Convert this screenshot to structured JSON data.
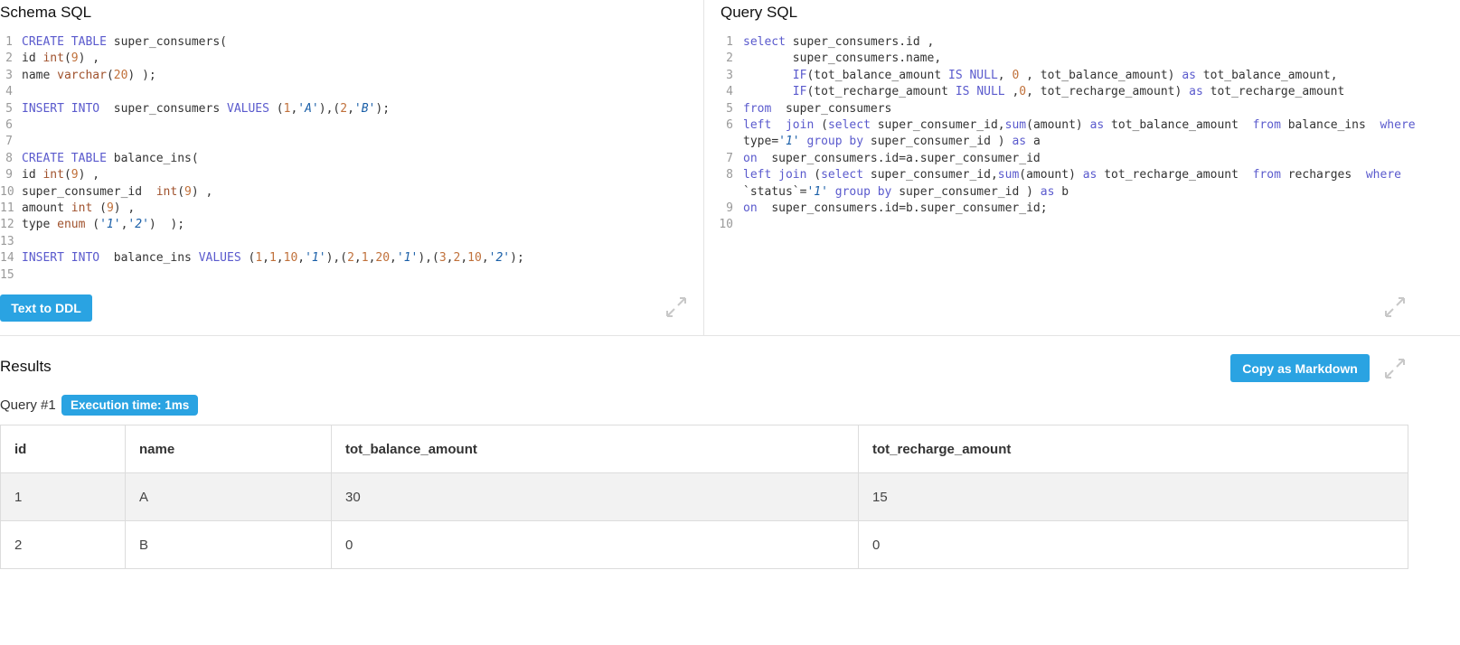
{
  "colors": {
    "accent": "#2aa3e2",
    "keyword": "#5a5acd",
    "type": "#a0522d",
    "string": "#1a5fa8",
    "number": "#c0703a",
    "line_number": "#9a9a9a"
  },
  "schema": {
    "title": "Schema SQL",
    "lines": [
      {
        "n": "1",
        "code": "CREATE TABLE super_consumers("
      },
      {
        "n": "2",
        "code": "id int(9) ,"
      },
      {
        "n": "3",
        "code": "name varchar(20) );"
      },
      {
        "n": "4",
        "code": ""
      },
      {
        "n": "5",
        "code": "INSERT INTO  super_consumers VALUES (1,'A'),(2,'B');"
      },
      {
        "n": "6",
        "code": ""
      },
      {
        "n": "7",
        "code": ""
      },
      {
        "n": "8",
        "code": "CREATE TABLE balance_ins("
      },
      {
        "n": "9",
        "code": "id int(9) ,"
      },
      {
        "n": "10",
        "code": "super_consumer_id  int(9) ,"
      },
      {
        "n": "11",
        "code": "amount int (9) ,"
      },
      {
        "n": "12",
        "code": "type enum ('1','2')  );"
      },
      {
        "n": "13",
        "code": ""
      },
      {
        "n": "14",
        "code": "INSERT INTO  balance_ins VALUES (1,1,10,'1'),(2,1,20,'1'),(3,2,10,'2');"
      },
      {
        "n": "15",
        "code": ""
      }
    ],
    "button_label": "Text to DDL",
    "expand_icon": "expand-icon"
  },
  "query": {
    "title": "Query SQL",
    "lines": [
      {
        "n": "1",
        "code": "select super_consumers.id ,"
      },
      {
        "n": "2",
        "code": "       super_consumers.name,"
      },
      {
        "n": "3",
        "code": "       IF(tot_balance_amount IS NULL, 0 , tot_balance_amount) as tot_balance_amount,"
      },
      {
        "n": "4",
        "code": "       IF(tot_recharge_amount IS NULL ,0, tot_recharge_amount) as tot_recharge_amount"
      },
      {
        "n": "5",
        "code": "from  super_consumers"
      },
      {
        "n": "6",
        "code": "left  join (select super_consumer_id,sum(amount) as tot_balance_amount  from balance_ins  where type='1' group by super_consumer_id ) as a"
      },
      {
        "n": "7",
        "code": "on  super_consumers.id=a.super_consumer_id"
      },
      {
        "n": "8",
        "code": "left join (select super_consumer_id,sum(amount) as tot_recharge_amount  from recharges  where `status`='1' group by super_consumer_id ) as b"
      },
      {
        "n": "9",
        "code": "on  super_consumers.id=b.super_consumer_id;"
      },
      {
        "n": "10",
        "code": ""
      }
    ],
    "expand_icon": "expand-icon"
  },
  "results": {
    "title": "Results",
    "copy_button": "Copy as Markdown",
    "query_label": "Query #1",
    "execution_time": "Execution time: 1ms",
    "columns": [
      "id",
      "name",
      "tot_balance_amount",
      "tot_recharge_amount"
    ],
    "rows": [
      [
        "1",
        "A",
        "30",
        "15"
      ],
      [
        "2",
        "B",
        "0",
        "0"
      ]
    ]
  }
}
